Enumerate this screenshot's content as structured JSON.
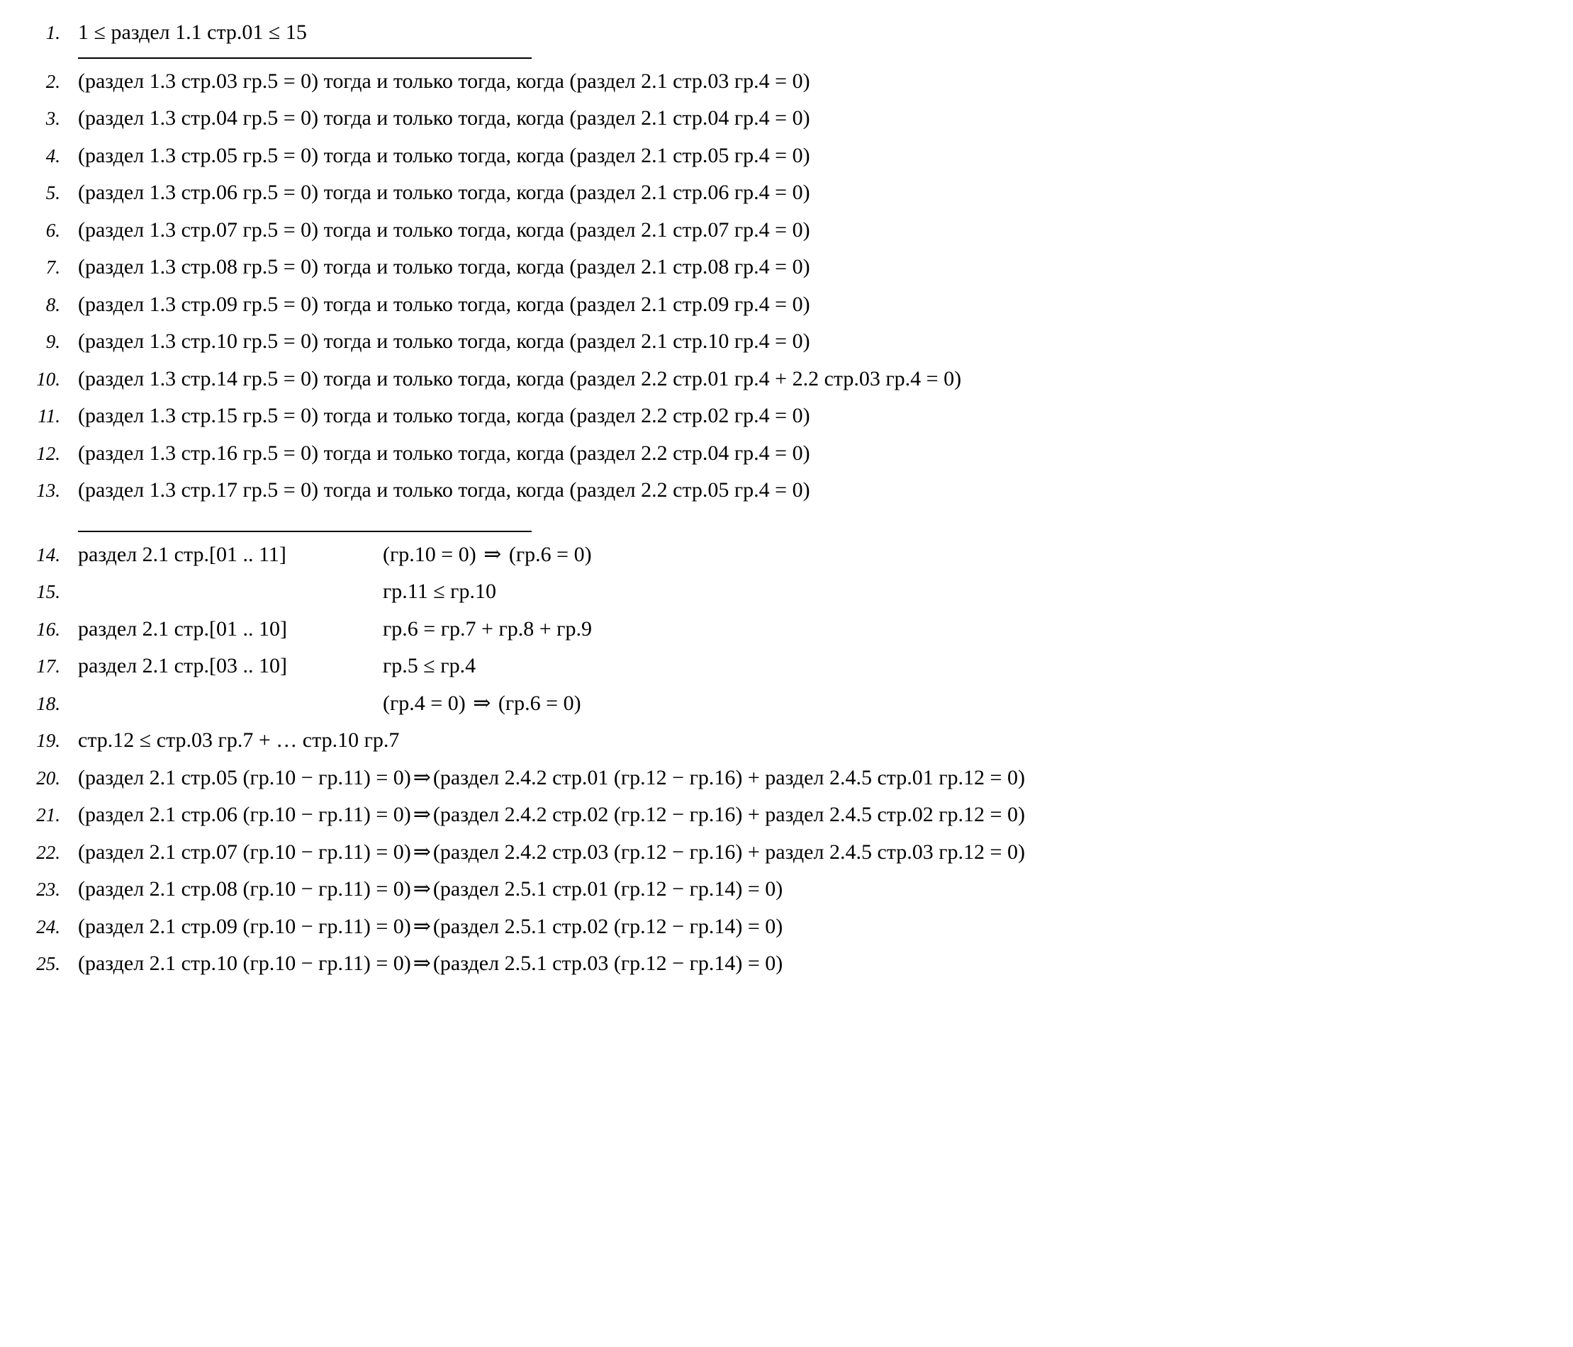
{
  "block1": {
    "rows": [
      {
        "num": "1.",
        "text": "1 ≤ раздел 1.1 стр.01 ≤ 15"
      }
    ]
  },
  "block2": {
    "rows": [
      {
        "num": "2.",
        "text": "(раздел 1.3 стр.03 гр.5 = 0) тогда и только тогда, когда (раздел 2.1 стр.03 гр.4 = 0)"
      },
      {
        "num": "3.",
        "text": "(раздел 1.3 стр.04 гр.5 = 0) тогда и только тогда, когда (раздел 2.1 стр.04 гр.4 = 0)"
      },
      {
        "num": "4.",
        "text": "(раздел 1.3 стр.05 гр.5 = 0) тогда и только тогда, когда (раздел 2.1 стр.05 гр.4 = 0)"
      },
      {
        "num": "5.",
        "text": "(раздел 1.3 стр.06 гр.5 = 0) тогда и только тогда, когда (раздел 2.1 стр.06 гр.4 = 0)"
      },
      {
        "num": "6.",
        "text": "(раздел 1.3 стр.07 гр.5 = 0) тогда и только тогда, когда (раздел 2.1 стр.07 гр.4 = 0)"
      },
      {
        "num": "7.",
        "text": "(раздел 1.3 стр.08 гр.5 = 0) тогда и только тогда, когда (раздел 2.1 стр.08 гр.4 = 0)"
      },
      {
        "num": "8.",
        "text": "(раздел 1.3 стр.09 гр.5 = 0) тогда и только тогда, когда (раздел 2.1 стр.09 гр.4 = 0)"
      },
      {
        "num": "9.",
        "text": "(раздел 1.3 стр.10 гр.5 = 0) тогда и только тогда, когда (раздел 2.1 стр.10 гр.4 = 0)"
      },
      {
        "num": "10.",
        "text": "(раздел 1.3 стр.14 гр.5 = 0) тогда и только тогда, когда (раздел 2.2 стр.01 гр.4 + 2.2 стр.03 гр.4 = 0)"
      },
      {
        "num": "11.",
        "text": "(раздел 1.3 стр.15 гр.5 = 0) тогда и только тогда, когда (раздел 2.2 стр.02 гр.4 = 0)"
      },
      {
        "num": "12.",
        "text": "(раздел 1.3 стр.16 гр.5 = 0) тогда и только тогда, когда (раздел 2.2 стр.04 гр.4 = 0)"
      },
      {
        "num": "13.",
        "text": "(раздел 1.3 стр.17 гр.5 = 0) тогда и только тогда, когда (раздел 2.2 стр.05 гр.4 = 0)"
      }
    ]
  },
  "block3": {
    "rows": [
      {
        "num": "14.",
        "left": "раздел 2.1 стр.[01 .. 11]",
        "right_parts": [
          "(гр.10 = 0) ",
          "⇒",
          " (гр.6 = 0)"
        ]
      },
      {
        "num": "15.",
        "left": "",
        "right_parts": [
          "гр.11 ≤ гр.10"
        ]
      },
      {
        "num": "16.",
        "left": "раздел 2.1 стр.[01 .. 10]",
        "right_parts": [
          "гр.6 = гр.7 + гр.8 + гр.9"
        ]
      },
      {
        "num": "17.",
        "left": "раздел 2.1 стр.[03 .. 10]",
        "right_parts": [
          "гр.5 ≤ гр.4"
        ]
      },
      {
        "num": "18.",
        "left": "",
        "right_parts": [
          "(гр.4 = 0) ",
          "⇒",
          " (гр.6 = 0)"
        ]
      }
    ]
  },
  "block4": {
    "rows": [
      {
        "num": "19.",
        "parts": [
          "стр.12 ≤ стр.03 гр.7 + … стр.10 гр.7"
        ]
      },
      {
        "num": "20.",
        "parts": [
          "(раздел 2.1 стр.05 (гр.10 − гр.11) = 0) ",
          "⇒",
          " (раздел 2.4.2 стр.01 (гр.12 − гр.16) + раздел 2.4.5 стр.01 гр.12 = 0)"
        ]
      },
      {
        "num": "21.",
        "parts": [
          "(раздел 2.1 стр.06 (гр.10 − гр.11) = 0) ",
          "⇒",
          " (раздел 2.4.2 стр.02 (гр.12 − гр.16) + раздел 2.4.5 стр.02 гр.12 = 0)"
        ]
      },
      {
        "num": "22.",
        "parts": [
          "(раздел 2.1 стр.07 (гр.10 − гр.11) = 0) ",
          "⇒",
          " (раздел 2.4.2 стр.03 (гр.12 − гр.16) + раздел 2.4.5 стр.03 гр.12 = 0)"
        ]
      },
      {
        "num": "23.",
        "parts": [
          "(раздел 2.1 стр.08 (гр.10 − гр.11) = 0) ",
          "⇒",
          " (раздел 2.5.1 стр.01 (гр.12 − гр.14) = 0)"
        ]
      },
      {
        "num": "24.",
        "parts": [
          "(раздел 2.1 стр.09 (гр.10 − гр.11) = 0) ",
          "⇒",
          " (раздел 2.5.1 стр.02 (гр.12 − гр.14) = 0)"
        ]
      },
      {
        "num": "25.",
        "parts": [
          "(раздел 2.1 стр.10 (гр.10 − гр.11) = 0) ",
          "⇒",
          " (раздел 2.5.1 стр.03 (гр.12 − гр.14) = 0)"
        ]
      }
    ]
  }
}
